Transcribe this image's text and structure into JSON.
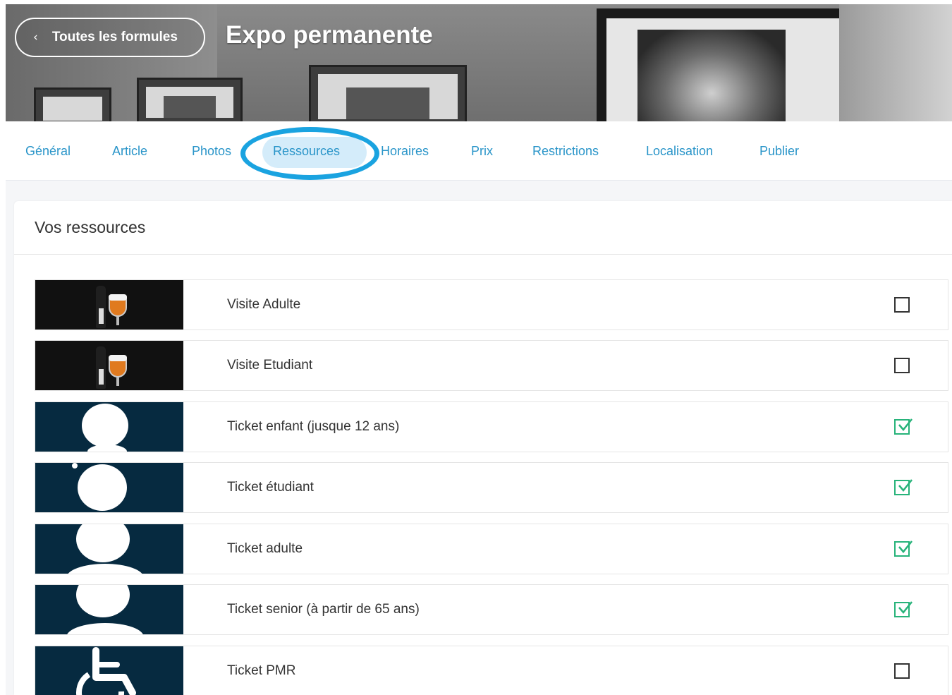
{
  "header": {
    "back_label": "Toutes les formules",
    "title": "Expo permanente"
  },
  "tabs": [
    {
      "label": "Général"
    },
    {
      "label": "Article"
    },
    {
      "label": "Photos"
    },
    {
      "label": "Ressources",
      "active": true
    },
    {
      "label": "Horaires"
    },
    {
      "label": "Prix"
    },
    {
      "label": "Restrictions"
    },
    {
      "label": "Localisation"
    },
    {
      "label": "Publier"
    }
  ],
  "resources": {
    "title": "Vos ressources",
    "items": [
      {
        "label": "Visite Adulte",
        "thumbnail": "beer-bottle-glass-image",
        "checked": false
      },
      {
        "label": "Visite Etudiant",
        "thumbnail": "beer-bottle-glass-image",
        "checked": false
      },
      {
        "label": "Ticket enfant (jusque 12 ans)",
        "thumbnail": "person-silhouette-icon",
        "checked": true
      },
      {
        "label": "Ticket étudiant",
        "thumbnail": "person-silhouette-icon",
        "checked": true
      },
      {
        "label": "Ticket adulte",
        "thumbnail": "person-silhouette-icon",
        "checked": true
      },
      {
        "label": "Ticket senior (à partir de 65 ans)",
        "thumbnail": "person-silhouette-icon",
        "checked": true
      },
      {
        "label": "Ticket PMR",
        "thumbnail": "wheelchair-icon",
        "checked": false
      }
    ]
  },
  "colors": {
    "tab_text": "#2a95c9",
    "active_tab_bg": "#d4ecfa",
    "highlight_ring": "#1aa3e0",
    "check_green": "#27b37a",
    "thumb_navy": "#062a40"
  }
}
